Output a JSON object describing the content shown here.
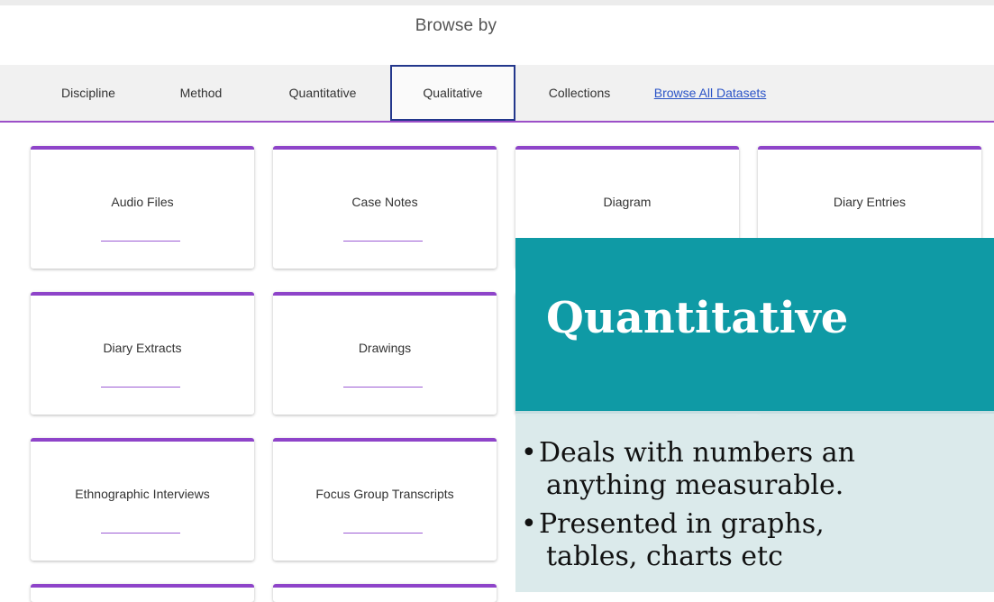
{
  "header": {
    "title": "Browse by"
  },
  "tabs": [
    {
      "label": "Discipline"
    },
    {
      "label": "Method"
    },
    {
      "label": "Quantitative"
    },
    {
      "label": "Qualitative",
      "active": true
    },
    {
      "label": "Collections"
    },
    {
      "label": "Browse All Datasets",
      "link": true
    }
  ],
  "cards": [
    {
      "label": "Audio Files"
    },
    {
      "label": "Case Notes"
    },
    {
      "label": "Diagram"
    },
    {
      "label": "Diary Entries"
    },
    {
      "label": "Diary Extracts"
    },
    {
      "label": "Drawings"
    },
    {
      "label": "Ethnographic Interviews"
    },
    {
      "label": "Focus Group Transcripts"
    }
  ],
  "overlay": {
    "title": "Quantitative",
    "bullets": [
      "Deals with numbers an",
      "anything measurable.",
      "Presented in graphs,",
      "tables, charts etc"
    ]
  },
  "colors": {
    "accent": "#8e44c9",
    "active_tab_border": "#23378c",
    "slide_teal": "#0f9aa5",
    "link": "#2b54c7"
  }
}
